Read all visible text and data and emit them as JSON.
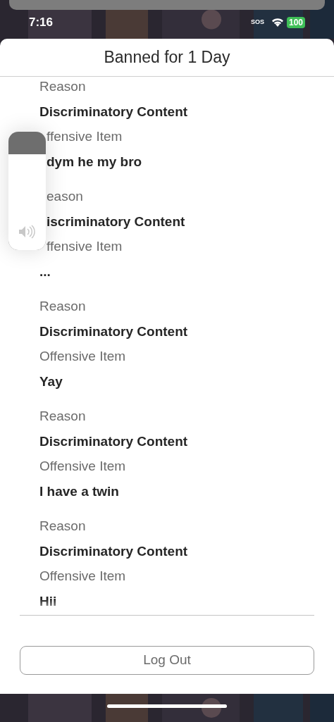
{
  "status_bar": {
    "time": "7:16",
    "carrier": "SOS",
    "battery": "100"
  },
  "volume": {
    "level": 0.81
  },
  "sheet": {
    "title": "Banned for 1 Day",
    "entries": [
      {
        "lines": [
          {
            "kind": "label",
            "text": "Reason",
            "covered": false
          },
          {
            "kind": "value",
            "text": "Discriminatory Content",
            "covered": false
          },
          {
            "kind": "label",
            "text": "ffensive Item",
            "covered": true
          },
          {
            "kind": "value",
            "text": "dym he my bro",
            "covered": true
          }
        ]
      },
      {
        "lines": [
          {
            "kind": "label",
            "text": "eason",
            "covered": true
          },
          {
            "kind": "value",
            "text": "iscriminatory Content",
            "covered": true
          },
          {
            "kind": "label",
            "text": "ffensive Item",
            "covered": true
          },
          {
            "kind": "value",
            "text": "...",
            "covered": false
          }
        ]
      },
      {
        "lines": [
          {
            "kind": "label",
            "text": "Reason",
            "covered": false
          },
          {
            "kind": "value",
            "text": "Discriminatory Content",
            "covered": false
          },
          {
            "kind": "label",
            "text": "Offensive Item",
            "covered": false
          },
          {
            "kind": "value",
            "text": "Yay",
            "covered": false
          }
        ]
      },
      {
        "lines": [
          {
            "kind": "label",
            "text": "Reason",
            "covered": false
          },
          {
            "kind": "value",
            "text": "Discriminatory Content",
            "covered": false
          },
          {
            "kind": "label",
            "text": "Offensive Item",
            "covered": false
          },
          {
            "kind": "value",
            "text": "I have a twin",
            "covered": false
          }
        ]
      },
      {
        "lines": [
          {
            "kind": "label",
            "text": "Reason",
            "covered": false
          },
          {
            "kind": "value",
            "text": "Discriminatory Content",
            "covered": false
          },
          {
            "kind": "label",
            "text": "Offensive Item",
            "covered": false
          },
          {
            "kind": "value",
            "text": "Hii",
            "covered": false
          }
        ]
      }
    ],
    "button": "Log Out"
  }
}
